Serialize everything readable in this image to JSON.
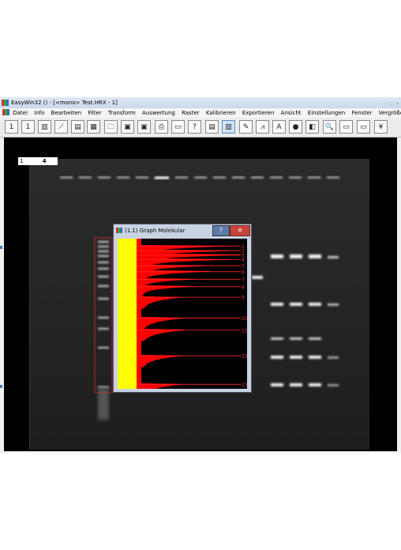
{
  "window": {
    "title": "EasyWin32 () - [<mono>  Test.HRX - 1]",
    "controls": "— ▢ ✕"
  },
  "menu": [
    "Datei",
    "Info",
    "Bearbeiten",
    "Filter",
    "Transform",
    "Auswertung",
    "Raster",
    "Kalibrieren",
    "Exportieren",
    "Ansicht",
    "Einstellungen",
    "Fenster",
    "Vergrößerung"
  ],
  "toolbar": {
    "buttons": [
      {
        "name": "tool-1-icon",
        "glyph": "1"
      },
      {
        "name": "tool-2-icon",
        "glyph": "1"
      },
      {
        "name": "tool-3-icon",
        "glyph": "▥"
      },
      {
        "name": "tool-4-icon",
        "glyph": "⟋"
      },
      {
        "name": "tool-5-icon",
        "glyph": "▤"
      },
      {
        "name": "tool-6-icon",
        "glyph": "▦"
      },
      {
        "name": "open-folder-icon",
        "glyph": "🗀"
      },
      {
        "name": "save-icon",
        "glyph": "▣"
      },
      {
        "name": "save-as-icon",
        "glyph": "▣"
      },
      {
        "name": "print-icon",
        "glyph": "⎙"
      },
      {
        "name": "image-icon",
        "glyph": "▭"
      },
      {
        "name": "help-icon",
        "glyph": "?"
      },
      {
        "name": "edit-icon",
        "glyph": "▤"
      },
      {
        "name": "lanes-icon",
        "glyph": "▥"
      },
      {
        "name": "brush-icon",
        "glyph": "✎"
      },
      {
        "name": "graph-icon",
        "glyph": "⩘"
      },
      {
        "name": "text-icon",
        "glyph": "A"
      },
      {
        "name": "color-icon",
        "glyph": "●"
      },
      {
        "name": "contrast-icon",
        "glyph": "◧"
      },
      {
        "name": "zoom-icon",
        "glyph": "🔍"
      },
      {
        "name": "window-icon",
        "glyph": "▭"
      },
      {
        "name": "window2-icon",
        "glyph": "▭"
      },
      {
        "name": "more-icon",
        "glyph": "¥"
      }
    ]
  },
  "coord_box": {
    "label": "1",
    "value": "4"
  },
  "graph_window": {
    "title": "(1.1)  Graph Molekular",
    "help": "?",
    "close": "✕",
    "peaks": [
      {
        "label": "1",
        "pos": 0.05
      },
      {
        "label": "2",
        "pos": 0.08
      },
      {
        "label": "3",
        "pos": 0.11
      },
      {
        "label": "4",
        "pos": 0.14
      },
      {
        "label": "5",
        "pos": 0.18
      },
      {
        "label": "6",
        "pos": 0.22
      },
      {
        "label": "7",
        "pos": 0.27
      },
      {
        "label": "8",
        "pos": 0.32
      },
      {
        "label": "9",
        "pos": 0.39
      },
      {
        "label": "10",
        "pos": 0.53
      },
      {
        "label": "11",
        "pos": 0.61
      },
      {
        "label": "12",
        "pos": 0.78
      },
      {
        "label": "13",
        "pos": 0.97
      }
    ]
  },
  "colors": {
    "profile_fill": "#ff0000",
    "baseline_band": "#ffff00",
    "marker_lines": "#ff2a2a",
    "band_glow": "#e8e8e8"
  }
}
